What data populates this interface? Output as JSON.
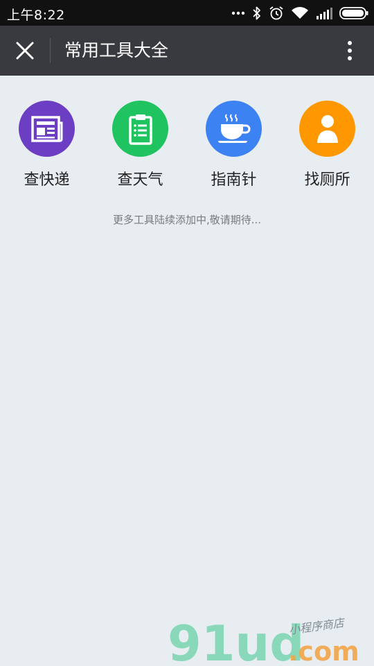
{
  "status_bar": {
    "time": "上午8:22",
    "icons": [
      "more-dots-icon",
      "bluetooth-icon",
      "alarm-icon",
      "wifi-icon",
      "signal-icon",
      "battery-icon"
    ]
  },
  "header": {
    "title": "常用工具大全",
    "close_icon": "close-icon",
    "menu_icon": "more-vertical-icon",
    "background": "#393a3f"
  },
  "tools": [
    {
      "label": "查快递",
      "icon": "newspaper-icon",
      "color": "#6c3ec4"
    },
    {
      "label": "查天气",
      "icon": "clipboard-icon",
      "color": "#1fc35f"
    },
    {
      "label": "指南针",
      "icon": "coffee-cup-icon",
      "color": "#3d82f3"
    },
    {
      "label": "找厕所",
      "icon": "person-icon",
      "color": "#ff9800"
    }
  ],
  "footer_note": "更多工具陆续添加中,敬请期待...",
  "watermark": {
    "brand": "91ud",
    "domain": ".com",
    "tagline": "小程序商店"
  },
  "colors": {
    "page_background": "#e8edf1",
    "status_background": "#111111"
  }
}
